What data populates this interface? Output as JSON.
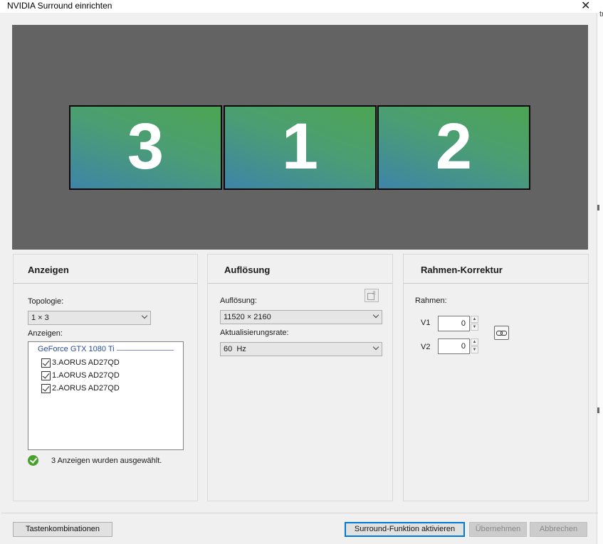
{
  "window": {
    "title": "NVIDIA Surround einrichten",
    "close_glyph": "✕",
    "bleed_text": "tra"
  },
  "preview": {
    "monitors": [
      {
        "number": "3"
      },
      {
        "number": "1"
      },
      {
        "number": "2"
      }
    ],
    "gradient_colors": [
      "#4ca552",
      "#4b9e73",
      "#3e84a8"
    ],
    "background": "#636363"
  },
  "anzeigen": {
    "title": "Anzeigen",
    "topologie_label": "Topologie:",
    "topologie_value": "1 × 3",
    "anzeigen_label": "Anzeigen:",
    "gpu": "GeForce GTX 1080 Ti",
    "displays": [
      {
        "label": "3.AORUS AD27QD",
        "checked": true
      },
      {
        "label": "1.AORUS AD27QD",
        "checked": true
      },
      {
        "label": "2.AORUS AD27QD",
        "checked": true
      }
    ],
    "status_icon": "check-circle-icon",
    "status": "3 Anzeigen wurden ausgewählt."
  },
  "aufloesung": {
    "title": "Auflösung",
    "aufloesung_label": "Auflösung:",
    "aufloesung_value": "11520 × 2160",
    "rate_label": "Aktualisierungsrate:",
    "rate_value": "60  Hz",
    "custom_icon": "custom-resolution-icon"
  },
  "rahmen": {
    "title": "Rahmen-Korrektur",
    "rahmen_label": "Rahmen:",
    "v1_label": "V1",
    "v1_value": "0",
    "v2_label": "V2",
    "v2_value": "0",
    "spin_up": "▲",
    "spin_down": "▼",
    "link_icon": "link-icon"
  },
  "footer": {
    "shortcuts": "Tastenkombinationen",
    "activate": "Surround-Funktion aktivieren",
    "apply": "Übernehmen",
    "cancel": "Abbrechen"
  },
  "colors": {
    "accent": "#0078d7",
    "status_ok": "#4aa02c"
  }
}
